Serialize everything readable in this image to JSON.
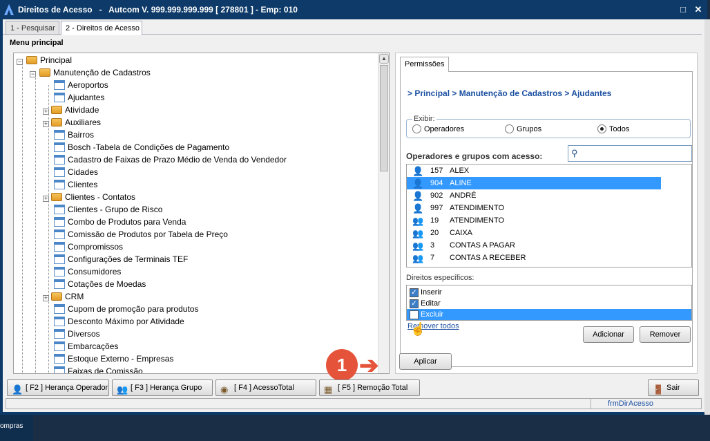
{
  "window": {
    "title": "Direitos de Acesso   -   Autcom V. 999.999.999.999 [ 278801 ] - Emp: 010",
    "controls": [
      "□",
      "✕"
    ]
  },
  "tabs": [
    {
      "label": "1 - Pesquisar"
    },
    {
      "label": "2 - Direitos de Acesso"
    }
  ],
  "menu_label": "Menu principal",
  "tree": {
    "items": [
      "Principal",
      "Manutenção de Cadastros",
      "Aeroportos",
      "Ajudantes",
      "Atividade",
      "Auxiliares",
      "Bairros",
      "Bosch -Tabela de Condições de Pagamento",
      "Cadastro de Faixas de Prazo Médio de Venda do Vendedor",
      "Cidades",
      "Clientes",
      "Clientes - Contatos",
      "Clientes - Grupo de Risco",
      "Combo de Produtos para Venda",
      "Comissão de Produtos por Tabela de Preço",
      "Compromissos",
      "Configurações de Terminais TEF",
      "Consumidores",
      "Cotações de Moedas",
      "CRM",
      "Cupom de promoção para produtos",
      "Desconto Máximo por Atividade",
      "Diversos",
      "Embarcações",
      "Estoque Externo - Empresas",
      "Faixas de Comissão"
    ]
  },
  "permissions": {
    "tab": "Permissões",
    "breadcrumb": "> Principal > Manutenção de Cadastros > Ajudantes",
    "exibir": {
      "legend": "Exibir:",
      "options": [
        "Operadores",
        "Grupos",
        "Todos"
      ],
      "selected": "Todos"
    },
    "list_label": "Operadores e grupos com acesso:",
    "search_value": "",
    "entries": [
      {
        "code": "157",
        "name": "ALEX"
      },
      {
        "code": "904",
        "name": "ALINE"
      },
      {
        "code": "902",
        "name": "ANDRÉ"
      },
      {
        "code": "997",
        "name": "ATENDIMENTO"
      },
      {
        "code": "19",
        "name": "ATENDIMENTO"
      },
      {
        "code": "20",
        "name": "CAIXA"
      },
      {
        "code": "3",
        "name": "CONTAS A PAGAR"
      },
      {
        "code": "7",
        "name": "CONTAS A RECEBER"
      }
    ],
    "rights_label": "Direitos específicos:",
    "rights": [
      {
        "label": "Inserir",
        "checked": true
      },
      {
        "label": "Editar",
        "checked": true
      },
      {
        "label": "Excluir",
        "checked": false
      }
    ],
    "remove_all": "Remover todos",
    "add_button": "Adicionar",
    "remove_button": "Remover"
  },
  "apply_button": "Aplicar",
  "badge": "1",
  "footer_buttons": [
    "[ F2 ] Herança Operador",
    "[ F3 ] Herança Grupo",
    "[ F4 ] AcessoTotal",
    "[ F5 ] Remoção Total"
  ],
  "exit_button": "Sair",
  "status": "frmDirAcesso",
  "taskbar": "ompras",
  "colors": {
    "title": "#0d3a68",
    "selection": "#3399ff",
    "accent": "#e5533a"
  }
}
